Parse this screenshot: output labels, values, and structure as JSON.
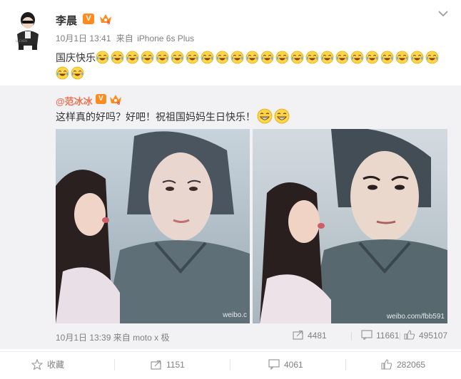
{
  "post": {
    "username": "李晨",
    "vip_badge": "V",
    "date": "10月1日 13:41",
    "source_prefix": "来自",
    "device": "iPhone 6s Plus",
    "text": "国庆快乐",
    "emoji_name": "laugh-cry-emoji",
    "emoji_count": 25
  },
  "repost": {
    "username": "@范冰冰",
    "vip_badge": "V",
    "text": "这样真的好吗？好吧！祝祖国妈妈生日快乐！",
    "date": "10月1日 13:39",
    "source_prefix": "来自",
    "device": "moto x 极",
    "photo_watermark_1": "weibo.c",
    "photo_watermark_2": "weibo.com/fbb591",
    "stats": {
      "reposts": "4481",
      "comments": "11661",
      "likes": "495107"
    }
  },
  "actions": {
    "favorite": "收藏",
    "repost": "1151",
    "comment": "4061",
    "like": "282065"
  },
  "colors": {
    "accent": "#eb7350",
    "badge": "#ff8a1e",
    "repost_bg": "#f2f2f5",
    "muted": "#808080"
  }
}
